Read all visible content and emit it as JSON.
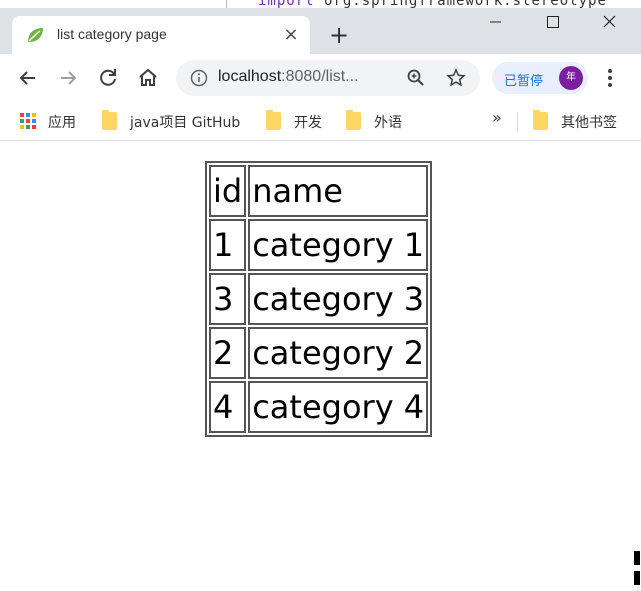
{
  "browser": {
    "tab": {
      "title": "list category page",
      "close_label": "×"
    },
    "new_tab_label": "+",
    "window_controls": {
      "minimize": "—",
      "maximize": "☐",
      "close": "✕"
    },
    "address": {
      "host": "localhost",
      "rest": ":8080/list..."
    },
    "profile": {
      "status_label": "已暂停",
      "avatar_text": "年"
    },
    "bookmarks": [
      {
        "label": "应用",
        "icon": "apps-grid-icon"
      },
      {
        "label": "java项目 GitHub",
        "icon": "folder-icon"
      },
      {
        "label": "开发",
        "icon": "folder-icon"
      },
      {
        "label": "外语",
        "icon": "folder-icon"
      }
    ],
    "bookmarks_more": "»",
    "other_bookmarks": "其他书签",
    "accent_color": "#1a73e8"
  },
  "background_code": {
    "keyword": "import",
    "text": "org.springframework.stereotype"
  },
  "page": {
    "table": {
      "headers": [
        "id",
        "name"
      ],
      "rows": [
        [
          "1",
          "category 1"
        ],
        [
          "3",
          "category 3"
        ],
        [
          "2",
          "category 2"
        ],
        [
          "4",
          "category 4"
        ]
      ]
    }
  }
}
